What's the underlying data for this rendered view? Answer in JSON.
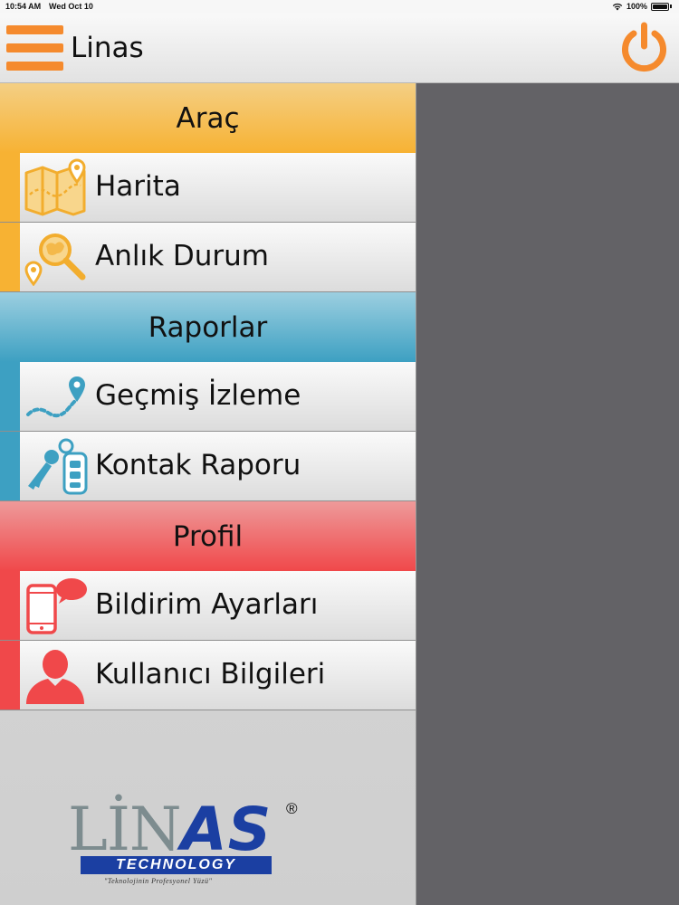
{
  "status_bar": {
    "time": "10:54 AM",
    "date": "Wed Oct 10",
    "battery": "100%"
  },
  "header": {
    "title": "Linas",
    "menu_icon": "hamburger-icon",
    "power_icon": "power-icon",
    "accent_color": "#f58a2d"
  },
  "menu": {
    "sections": [
      {
        "title": "Araç",
        "color": "#f7b233",
        "items": [
          {
            "label": "Harita",
            "icon": "map-icon"
          },
          {
            "label": "Anlık Durum",
            "icon": "location-search-icon"
          }
        ]
      },
      {
        "title": "Raporlar",
        "color": "#3da0c2",
        "items": [
          {
            "label": "Geçmiş İzleme",
            "icon": "route-history-icon"
          },
          {
            "label": "Kontak Raporu",
            "icon": "car-key-icon"
          }
        ]
      },
      {
        "title": "Profil",
        "color": "#f0484a",
        "items": [
          {
            "label": "Bildirim Ayarları",
            "icon": "phone-notification-icon"
          },
          {
            "label": "Kullanıcı Bilgileri",
            "icon": "user-icon"
          }
        ]
      }
    ]
  },
  "logo": {
    "brand_part1": "LİN",
    "brand_part2": "AS",
    "registered": "®",
    "subtitle": "TECHNOLOGY",
    "tagline": "\"Teknolojinin Profesyonel Yüzü\""
  }
}
